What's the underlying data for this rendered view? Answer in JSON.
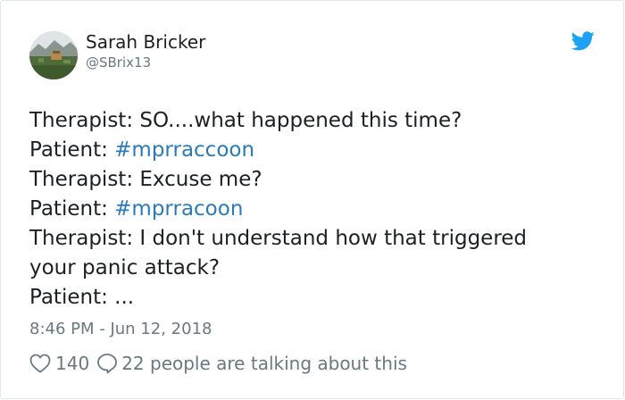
{
  "author": {
    "display_name": "Sarah Bricker",
    "handle": "@SBrix13",
    "avatar_icon": "landscape-avatar"
  },
  "brand": {
    "icon": "twitter-bird-icon",
    "color": "#1da1f2"
  },
  "tweet": {
    "lines": [
      {
        "text": "Therapist: SO....what happened this time?",
        "hashtag": ""
      },
      {
        "text": "Patient: ",
        "hashtag": "#mprraccoon"
      },
      {
        "text": "Therapist: Excuse me?",
        "hashtag": ""
      },
      {
        "text": "Patient: ",
        "hashtag": "#mprracoon"
      },
      {
        "text": "Therapist: I don't understand how that triggered",
        "hashtag": ""
      },
      {
        "text": "your panic attack?",
        "hashtag": ""
      },
      {
        "text": "Patient: ...",
        "hashtag": ""
      }
    ],
    "hashtag_color": "#2b7bb9",
    "timestamp": "8:46 PM - Jun 12, 2018"
  },
  "engagement": {
    "likes": "140",
    "talking_text": "22 people are talking about this",
    "like_icon": "heart-icon",
    "reply_icon": "speech-bubble-icon"
  }
}
